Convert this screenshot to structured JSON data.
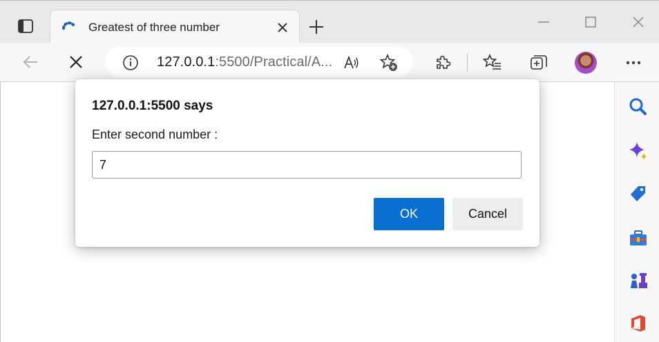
{
  "tab": {
    "title": "Greatest of three number",
    "loading_icon": "loading-spinner-icon"
  },
  "address_bar": {
    "url_host": "127.0.0.1",
    "url_rest": ":5500/Practical/A..."
  },
  "dialog": {
    "origin": "127.0.0.1:5500 says",
    "message": "Enter second number :",
    "input_value": "7",
    "ok_label": "OK",
    "cancel_label": "Cancel"
  },
  "toolbar_icons": [
    "back-arrow-icon",
    "stop-loading-icon",
    "extensions-icon",
    "favorites-icon",
    "collections-icon",
    "profile-avatar",
    "more-options-icon"
  ],
  "sidebar_icons": [
    "search-icon",
    "copilot-sparkle-icon",
    "shopping-tag-icon",
    "tools-toolbox-icon",
    "games-chess-icon",
    "office-icon"
  ],
  "colors": {
    "accent": "#0a6fd3",
    "titlebar_bg": "#e9e9e9",
    "toolbar_bg": "#f7f7f7"
  }
}
